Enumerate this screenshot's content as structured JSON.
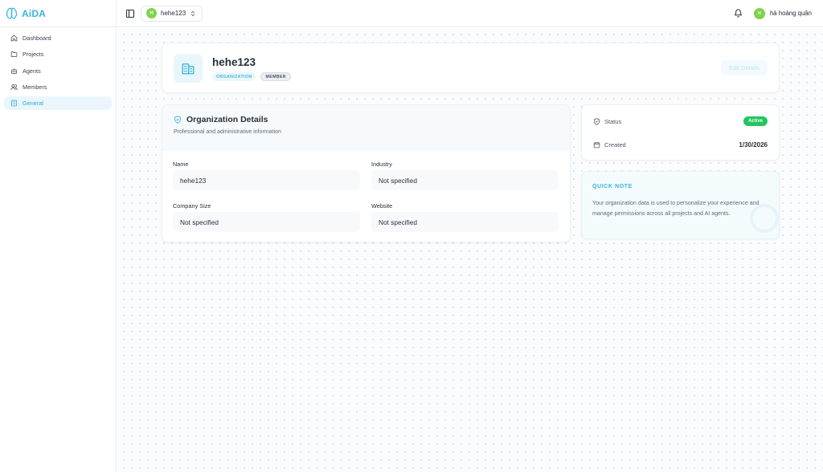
{
  "app": {
    "name": "AiDA"
  },
  "sidebar": {
    "items": [
      {
        "label": "Dashboard",
        "icon": "home-icon"
      },
      {
        "label": "Projects",
        "icon": "folder-icon"
      },
      {
        "label": "Agents",
        "icon": "bot-icon"
      },
      {
        "label": "Members",
        "icon": "users-icon"
      },
      {
        "label": "General",
        "icon": "building-icon",
        "active": true
      }
    ]
  },
  "topbar": {
    "org_avatar": "H",
    "org_name": "hehe123",
    "user_avatar": "H",
    "user_name": "hà hoàng quân"
  },
  "header": {
    "title": "hehe123",
    "badge_org": "ORGANIZATION",
    "badge_member": "MEMBER",
    "edit_label": "Edit Details"
  },
  "details": {
    "title": "Organization Details",
    "subtitle": "Professional and administrative information",
    "fields": [
      {
        "label": "Name",
        "value": "hehe123"
      },
      {
        "label": "Industry",
        "value": "Not specified"
      },
      {
        "label": "Company Size",
        "value": "Not specified"
      },
      {
        "label": "Website",
        "value": "Not specified"
      }
    ]
  },
  "status": {
    "status_label": "Status",
    "status_value": "Active",
    "created_label": "Created",
    "created_value": "1/30/2026"
  },
  "note": {
    "title": "QUICK NOTE",
    "body": "Your organization data is used to personalize your experience and manage permissions across all projects and AI agents."
  },
  "colors": {
    "accent": "#3bb3da",
    "active_badge": "#22c55e",
    "avatar": "#7fd34b"
  }
}
